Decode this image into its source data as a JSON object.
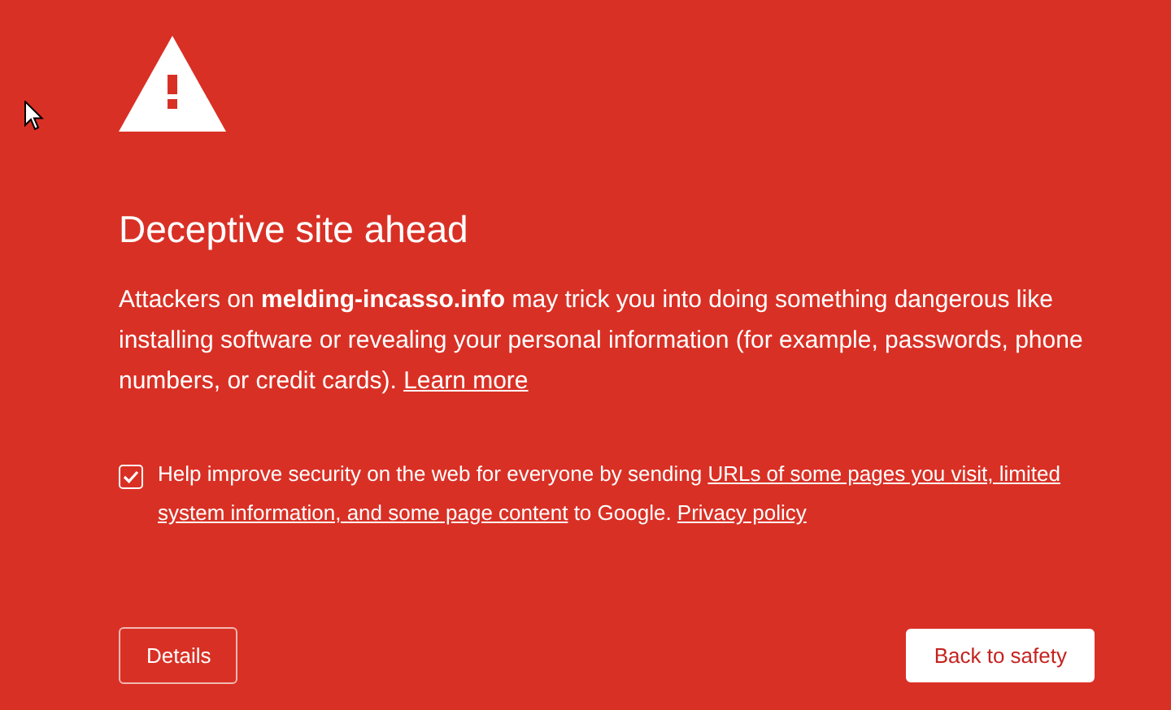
{
  "title": "Deceptive site ahead",
  "description": {
    "text": "Attackers on **melding-incasso.info** may trick you into doing something dangerous like installing software or revealing your personal information (for example, passwords, phone numbers, or credit cards).",
    "link": "Learn more"
  },
  "consent": {
    "checked": true,
    "lines": [
      [
        {
          "kind": "text",
          "text": "Help improve security on the web for everyone by sending "
        },
        {
          "kind": "link",
          "text": "URLs of some pages you visit, limited"
        }
      ],
      [
        {
          "kind": "link",
          "text": "system information, and some page content"
        },
        {
          "kind": "text",
          "text": " to Google. "
        },
        {
          "kind": "link",
          "text": "Privacy policy"
        }
      ]
    ]
  },
  "buttons": {
    "secondary": "Details",
    "primary": "Back to safety"
  }
}
